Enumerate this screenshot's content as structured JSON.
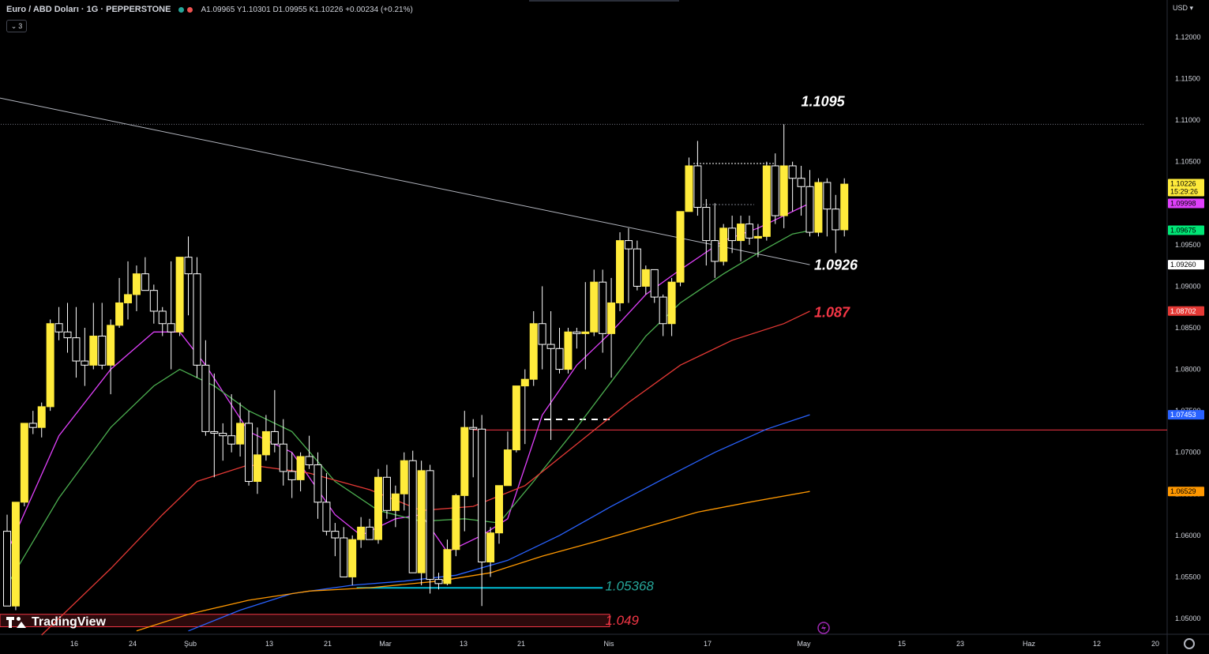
{
  "header": {
    "symbol": "Euro / ABD Doları · 1G · PEPPERSTONE",
    "ohlc": "A1.09965 Y1.10301 D1.09955 K1.10226 +0.00234 (+0.21%)",
    "indicator_count": "3",
    "status_colors": [
      "#26a69a",
      "#ef5350"
    ]
  },
  "currency": "USD",
  "logo": "TradingView",
  "chart_data": {
    "type": "candlestick",
    "title": "Euro / ABD Doları · 1G · PEPPERSTONE",
    "ylim": [
      1.0485,
      1.1225
    ],
    "y_ticks": [
      "1.12000",
      "1.11500",
      "1.11000",
      "1.10500",
      "1.10000",
      "1.09500",
      "1.09000",
      "1.08500",
      "1.08000",
      "1.07500",
      "1.07000",
      "1.06500",
      "1.06000",
      "1.05500",
      "1.05000"
    ],
    "x_ticks": [
      "16",
      "24",
      "Şub",
      "13",
      "21",
      "Mar",
      "13",
      "21",
      "Nis",
      "17",
      "May",
      "15",
      "23",
      "Haz",
      "12",
      "20"
    ],
    "candles": [
      [
        1.0605,
        1.0625,
        1.0515,
        1.0515
      ],
      [
        1.0515,
        1.064,
        1.051,
        1.064
      ],
      [
        1.064,
        1.0735,
        1.0635,
        1.0735
      ],
      [
        1.0735,
        1.075,
        1.0722,
        1.073
      ],
      [
        1.073,
        1.076,
        1.0718,
        1.0755
      ],
      [
        1.0755,
        1.086,
        1.075,
        1.0855
      ],
      [
        1.0855,
        1.0875,
        1.0835,
        1.0845
      ],
      [
        1.0845,
        1.088,
        1.082,
        1.0838
      ],
      [
        1.0838,
        1.0875,
        1.079,
        1.081
      ],
      [
        1.081,
        1.085,
        1.078,
        1.0805
      ],
      [
        1.0805,
        1.088,
        1.08,
        1.084
      ],
      [
        1.084,
        1.088,
        1.08,
        1.0805
      ],
      [
        1.0805,
        1.086,
        1.077,
        1.0853
      ],
      [
        1.0853,
        1.091,
        1.085,
        1.088
      ],
      [
        1.088,
        1.093,
        1.086,
        1.089
      ],
      [
        1.089,
        1.0925,
        1.087,
        1.0915
      ],
      [
        1.0915,
        1.0935,
        1.0895,
        1.0895
      ],
      [
        1.0895,
        1.0902,
        1.0855,
        1.087
      ],
      [
        1.087,
        1.0875,
        1.084,
        1.0855
      ],
      [
        1.0855,
        1.093,
        1.08,
        1.0845
      ],
      [
        1.0845,
        1.0935,
        1.084,
        1.0935
      ],
      [
        1.0935,
        1.096,
        1.0865,
        1.0915
      ],
      [
        1.0915,
        1.0935,
        1.079,
        1.0805
      ],
      [
        1.0805,
        1.0835,
        1.072,
        1.0725
      ],
      [
        1.0725,
        1.0795,
        1.067,
        1.0723
      ],
      [
        1.0723,
        1.0735,
        1.069,
        1.072
      ],
      [
        1.072,
        1.077,
        1.07,
        1.071
      ],
      [
        1.071,
        1.076,
        1.0695,
        1.0735
      ],
      [
        1.0735,
        1.075,
        1.066,
        1.0665
      ],
      [
        1.0665,
        1.073,
        1.065,
        1.0697
      ],
      [
        1.0697,
        1.0745,
        1.069,
        1.0725
      ],
      [
        1.0725,
        1.0775,
        1.07,
        1.071
      ],
      [
        1.071,
        1.074,
        1.066,
        1.0677
      ],
      [
        1.0677,
        1.07,
        1.0645,
        1.0667
      ],
      [
        1.0667,
        1.07,
        1.0653,
        1.0695
      ],
      [
        1.0695,
        1.072,
        1.068,
        1.0685
      ],
      [
        1.0685,
        1.07,
        1.062,
        1.064
      ],
      [
        1.064,
        1.0675,
        1.06,
        1.0605
      ],
      [
        1.0605,
        1.0615,
        1.0575,
        1.0597
      ],
      [
        1.0597,
        1.061,
        1.055,
        1.055
      ],
      [
        1.055,
        1.06,
        1.054,
        1.0595
      ],
      [
        1.0595,
        1.0622,
        1.0585,
        1.061
      ],
      [
        1.061,
        1.062,
        1.0595,
        1.0595
      ],
      [
        1.0595,
        1.068,
        1.059,
        1.067
      ],
      [
        1.067,
        1.0685,
        1.062,
        1.063
      ],
      [
        1.063,
        1.066,
        1.061,
        1.065
      ],
      [
        1.065,
        1.07,
        1.063,
        1.069
      ],
      [
        1.069,
        1.0702,
        1.0555,
        1.0555
      ],
      [
        1.0555,
        1.069,
        1.054,
        1.0678
      ],
      [
        1.0678,
        1.0685,
        1.053,
        1.0547
      ],
      [
        1.0547,
        1.0555,
        1.0535,
        1.0542
      ],
      [
        1.0542,
        1.0595,
        1.054,
        1.0583
      ],
      [
        1.0583,
        1.065,
        1.0575,
        1.0648
      ],
      [
        1.0648,
        1.075,
        1.0605,
        1.073
      ],
      [
        1.073,
        1.074,
        1.067,
        1.0728
      ],
      [
        1.0728,
        1.0745,
        1.0515,
        1.0568
      ],
      [
        1.0568,
        1.061,
        1.055,
        1.0603
      ],
      [
        1.0603,
        1.066,
        1.059,
        1.066
      ],
      [
        1.066,
        1.0725,
        1.066,
        1.0703
      ],
      [
        1.0703,
        1.078,
        1.07,
        1.078
      ],
      [
        1.078,
        1.08,
        1.071,
        1.0788
      ],
      [
        1.0788,
        1.087,
        1.078,
        1.0855
      ],
      [
        1.0855,
        1.09,
        1.08,
        1.083
      ],
      [
        1.083,
        1.087,
        1.0715,
        1.0825
      ],
      [
        1.0825,
        1.085,
        1.0795,
        1.08
      ],
      [
        1.08,
        1.085,
        1.0795,
        1.0845
      ],
      [
        1.0845,
        1.085,
        1.0825,
        1.0843
      ],
      [
        1.0843,
        1.0905,
        1.08,
        1.0845
      ],
      [
        1.0845,
        1.092,
        1.084,
        1.0905
      ],
      [
        1.0905,
        1.092,
        1.082,
        1.0843
      ],
      [
        1.0843,
        1.091,
        1.079,
        1.088
      ],
      [
        1.088,
        1.0965,
        1.087,
        1.0955
      ],
      [
        1.0955,
        1.097,
        1.088,
        1.0945
      ],
      [
        1.0945,
        1.0955,
        1.0895,
        1.09
      ],
      [
        1.09,
        1.0925,
        1.089,
        1.092
      ],
      [
        1.092,
        1.092,
        1.088,
        1.0887
      ],
      [
        1.0887,
        1.089,
        1.084,
        1.0855
      ],
      [
        1.0855,
        1.091,
        1.084,
        1.0905
      ],
      [
        1.0905,
        1.099,
        1.09,
        1.099
      ],
      [
        1.099,
        1.1055,
        1.099,
        1.1045
      ],
      [
        1.1045,
        1.1075,
        1.0985,
        1.0995
      ],
      [
        1.0995,
        1.1005,
        1.0925,
        1.0955
      ],
      [
        1.0955,
        1.1,
        1.091,
        1.093
      ],
      [
        1.093,
        1.0975,
        1.0925,
        1.097
      ],
      [
        1.097,
        1.0985,
        1.094,
        1.0955
      ],
      [
        1.0955,
        1.0985,
        1.093,
        1.0975
      ],
      [
        1.0975,
        1.0985,
        1.095,
        1.0958
      ],
      [
        1.0958,
        1.0975,
        1.0935,
        1.096
      ],
      [
        1.096,
        1.105,
        1.0955,
        1.1045
      ],
      [
        1.1045,
        1.106,
        1.0975,
        1.0985
      ],
      [
        1.0985,
        1.1095,
        1.097,
        1.1045
      ],
      [
        1.1045,
        1.105,
        1.099,
        1.103
      ],
      [
        1.103,
        1.1045,
        1.0985,
        1.102
      ],
      [
        1.102,
        1.104,
        1.096,
        1.0965
      ],
      [
        1.0965,
        1.103,
        1.096,
        1.1025
      ],
      [
        1.1025,
        1.103,
        1.096,
        1.0993
      ],
      [
        1.0993,
        1.101,
        1.094,
        1.0968
      ],
      [
        1.0968,
        1.103,
        1.096,
        1.1023
      ]
    ],
    "lines": [
      {
        "name": "trendline",
        "color": "#b2b5be",
        "points": [
          [
            -1,
            1.1127
          ],
          [
            93,
            1.0926
          ]
        ]
      },
      {
        "name": "support",
        "color": "#00bcd4",
        "points": [
          [
            40.5,
            1.05368
          ],
          [
            69,
            1.05368
          ]
        ]
      },
      {
        "name": "horizontal",
        "color": "#f23645",
        "points": [
          [
            54,
            1.0727
          ],
          [
            127,
            1.0727
          ]
        ]
      },
      {
        "name": "resistance",
        "color": "#787b86",
        "points": [
          [
            -1,
            1.1095
          ],
          [
            127,
            1.1095
          ]
        ]
      }
    ],
    "ma_lines": [
      {
        "color": "#e040fb",
        "points": [
          [
            0,
            1.058
          ],
          [
            6,
            1.072
          ],
          [
            12,
            1.08
          ],
          [
            17,
            1.0845
          ],
          [
            20,
            1.0845
          ],
          [
            23,
            1.0805
          ],
          [
            28,
            1.0725
          ],
          [
            33,
            1.07
          ],
          [
            38,
            1.0625
          ],
          [
            41,
            1.06
          ],
          [
            45,
            1.062
          ],
          [
            48,
            1.0625
          ],
          [
            51,
            1.058
          ],
          [
            55,
            1.06
          ],
          [
            58,
            1.062
          ],
          [
            62,
            1.0745
          ],
          [
            66,
            1.0805
          ],
          [
            70,
            1.0845
          ],
          [
            74,
            1.089
          ],
          [
            78,
            1.092
          ],
          [
            83,
            1.0955
          ],
          [
            87,
            1.097
          ],
          [
            90,
            1.0985
          ],
          [
            93,
            1.1
          ]
        ]
      },
      {
        "color": "#4caf50",
        "points": [
          [
            0,
            1.054
          ],
          [
            6,
            1.0645
          ],
          [
            12,
            1.073
          ],
          [
            17,
            1.078
          ],
          [
            20,
            1.08
          ],
          [
            24,
            1.078
          ],
          [
            28,
            1.075
          ],
          [
            33,
            1.0725
          ],
          [
            38,
            1.0665
          ],
          [
            43,
            1.063
          ],
          [
            48,
            1.0617
          ],
          [
            53,
            1.062
          ],
          [
            57,
            1.0615
          ],
          [
            61,
            1.0665
          ],
          [
            66,
            1.073
          ],
          [
            70,
            1.0785
          ],
          [
            74,
            1.084
          ],
          [
            78,
            1.088
          ],
          [
            83,
            1.0915
          ],
          [
            87,
            1.094
          ],
          [
            91,
            1.0963
          ],
          [
            93,
            1.0967
          ]
        ]
      },
      {
        "color": "#e53935",
        "points": [
          [
            4,
            1.048
          ],
          [
            12,
            1.056
          ],
          [
            18,
            1.0625
          ],
          [
            22,
            1.0665
          ],
          [
            28,
            1.0685
          ],
          [
            35,
            1.0675
          ],
          [
            42,
            1.0655
          ],
          [
            48,
            1.063
          ],
          [
            54,
            1.0635
          ],
          [
            60,
            1.066
          ],
          [
            66,
            1.071
          ],
          [
            72,
            1.076
          ],
          [
            78,
            1.0805
          ],
          [
            84,
            1.0835
          ],
          [
            90,
            1.0855
          ],
          [
            93,
            1.087
          ]
        ]
      },
      {
        "color": "#2962ff",
        "points": [
          [
            21,
            1.0485
          ],
          [
            27,
            1.051
          ],
          [
            33,
            1.053
          ],
          [
            40,
            1.054
          ],
          [
            46,
            1.0545
          ],
          [
            52,
            1.0552
          ],
          [
            58,
            1.057
          ],
          [
            64,
            1.06
          ],
          [
            70,
            1.0635
          ],
          [
            76,
            1.0668
          ],
          [
            82,
            1.07
          ],
          [
            88,
            1.0728
          ],
          [
            93,
            1.07453
          ]
        ]
      },
      {
        "color": "#ff9800",
        "points": [
          [
            15,
            1.0485
          ],
          [
            21,
            1.0505
          ],
          [
            28,
            1.0522
          ],
          [
            35,
            1.0533
          ],
          [
            42,
            1.0537
          ],
          [
            50,
            1.0545
          ],
          [
            56,
            1.0555
          ],
          [
            62,
            1.0575
          ],
          [
            68,
            1.0592
          ],
          [
            74,
            1.061
          ],
          [
            80,
            1.0628
          ],
          [
            86,
            1.064
          ],
          [
            93,
            1.06529
          ]
        ]
      }
    ],
    "annotations": [
      {
        "text": "1.1095",
        "color": "#ffffff",
        "at": [
          92,
          1.1117
        ]
      },
      {
        "text": "1.0926",
        "color": "#ffffff",
        "at": [
          93.5,
          1.092
        ]
      },
      {
        "text": "1.087",
        "color": "#f23645",
        "at": [
          93.5,
          1.0863
        ]
      },
      {
        "text": "1.05368",
        "color": "#26a69a",
        "at": [
          69.3,
          1.0534
        ]
      },
      {
        "text": "1.049",
        "color": "#f23645",
        "at": [
          69.3,
          1.04925
        ]
      }
    ],
    "price_labels": [
      {
        "text": "1.10226",
        "sub": "15:29:26",
        "bg": "#ffeb3b",
        "fg": "#000000",
        "price": 1.10226
      },
      {
        "text": "1.09998",
        "bg": "#e040fb",
        "fg": "#000000",
        "price": 1.09998
      },
      {
        "text": "1.09675",
        "bg": "#00e676",
        "fg": "#000000",
        "price": 1.09675
      },
      {
        "text": "1.09260",
        "bg": "#ffffff",
        "fg": "#000000",
        "price": 1.0926
      },
      {
        "text": "1.08702",
        "bg": "#e53935",
        "fg": "#ffffff",
        "price": 1.08702
      },
      {
        "text": "1.07453",
        "bg": "#2962ff",
        "fg": "#ffffff",
        "price": 1.07453
      },
      {
        "text": "1.06529",
        "bg": "#ff9800",
        "fg": "#000000",
        "price": 1.06529
      }
    ],
    "colors": {
      "bull": "#ffeb3b",
      "bear": "#000000",
      "wick": "#ffffff"
    }
  }
}
